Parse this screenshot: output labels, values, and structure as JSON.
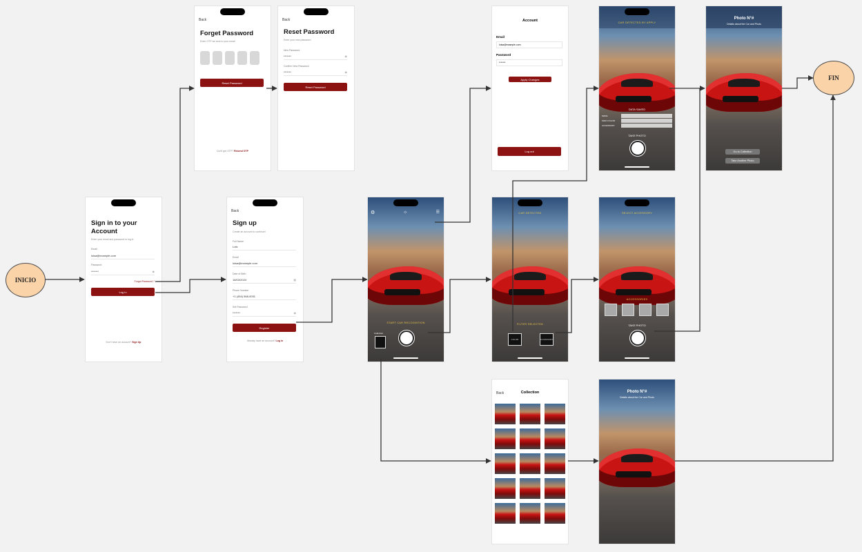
{
  "nodes": {
    "start": "INICIO",
    "end": "FIN"
  },
  "login": {
    "title_line1": "Sign in to your",
    "title_line2": "Account",
    "subtitle": "Enter your email and password to log in",
    "email_label": "Email",
    "email_value": "loisa@example.com",
    "password_label": "Password",
    "password_value": "*******",
    "forgot_link": "Forgot Password ?",
    "login_button": "Log In",
    "footer_text": "Don't have an account?",
    "footer_link": "Sign Up"
  },
  "forget": {
    "back": "Back",
    "title": "Forget Password",
    "subtitle": "Enter OTP we sent to your email",
    "button": "Reset Password",
    "footer_text": "Don't get OTP?",
    "footer_link": "Resend OTP"
  },
  "reset": {
    "back": "Back",
    "title": "Reset Password",
    "subtitle": "Enter your new password",
    "new_label": "New Password",
    "new_value": "*******",
    "confirm_label": "Confirm New Password",
    "confirm_value": "*******",
    "button": "Reset Password"
  },
  "signup": {
    "back": "Back",
    "title": "Sign up",
    "subtitle": "Create an account to continue!",
    "name_label": "Full Name",
    "name_value": "Lois",
    "email_label": "Email",
    "email_value": "loisa@example.com",
    "birth_label": "Date of Birth",
    "birth_value": "18/03/2024",
    "phone_label": "Phone Number",
    "phone_value": "+1 (454) 568-0031",
    "password_label": "Set Password",
    "password_value": "*******",
    "button": "Register",
    "footer_text": "Already have an account?",
    "footer_link": "Log in"
  },
  "account": {
    "title": "Account",
    "email_label": "Email",
    "email_value": "loisa@example.com",
    "password_label": "Password",
    "password_value": "*******",
    "apply_button": "Apply Changes",
    "logout_button": "Log out"
  },
  "camera": {
    "start_text": "START CAR RECOGNITION",
    "small_label": "Collection"
  },
  "detect": {
    "top": "CAR DETECTED",
    "filter": "FILTER SELECTED",
    "opt1": "COLOR",
    "opt2": "ACCESSORY"
  },
  "details": {
    "top": "CAR DETECTED BY APPLY",
    "overlay": "DATA SAVED",
    "row1": "MAKE",
    "row2": "MAIN COLOR",
    "row3": "ACCESSORY",
    "take": "TAKE PHOTO"
  },
  "accessory": {
    "top": "SELECT ACCESSORY",
    "label": "ACCESSORIES",
    "take": "TAKE PHOTO"
  },
  "photo1": {
    "title": "Photo N°#",
    "subtitle": "Details about the Car and Photo",
    "btn1": "Go to Collection",
    "btn2": "Take Another Photo"
  },
  "collection": {
    "back": "Back",
    "title": "Collection"
  },
  "photo2": {
    "title": "Photo N°#",
    "subtitle": "Details about the Car and Photo"
  }
}
